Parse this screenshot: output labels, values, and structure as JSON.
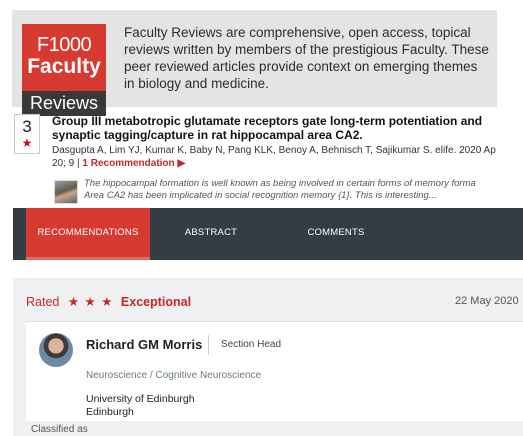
{
  "logo": {
    "line1": "F1000",
    "line2": "Faculty",
    "line3": "Reviews"
  },
  "banner": {
    "description": "Faculty Reviews are comprehensive, open access, topical reviews written by members of the prestigious Faculty. These peer reviewed articles provide context on emerging themes in biology and medicine."
  },
  "article": {
    "rank": "3",
    "rank_icon": "star-icon",
    "title_line1": "Group III metabotropic glutamate receptors gate long-term potentiation and",
    "title_line2": "synaptic tagging/capture in rat hippocampal area CA2.",
    "authors": "Dasgupta A, Lim YJ, Kumar K, Baby N, Pang KLK, Benoy A, Behnisch T, Sajikumar S. elife. 2020 Ap",
    "volume": "20; 9 |",
    "recommendation_link": "1 Recommendation",
    "recommendation_arrow": "▶",
    "snippet_line1": "The hippocampal formation is well known as being involved in certain forms of memory forma",
    "snippet_line2": "Area CA2 has been implicated in social recognition memory {1}. This is interesting..."
  },
  "tabs": [
    {
      "label": "RECOMMENDATIONS",
      "active": true
    },
    {
      "label": "ABSTRACT",
      "active": false
    },
    {
      "label": "COMMENTS",
      "active": false
    }
  ],
  "recommendation": {
    "rated_label": "Rated",
    "stars": "★ ★ ★",
    "rating": "Exceptional",
    "date": "22 May 2020",
    "reviewer": {
      "name": "Richard GM Morris",
      "role": "Section Head",
      "field": "Neuroscience / Cognitive Neuroscience",
      "affiliation": "University of Edinburgh",
      "city": "Edinburgh"
    },
    "classified_label": "Classified as"
  },
  "colors": {
    "brand_red": "#d63a30",
    "tab_bar": "#343c44",
    "accent_text": "#c62828"
  }
}
